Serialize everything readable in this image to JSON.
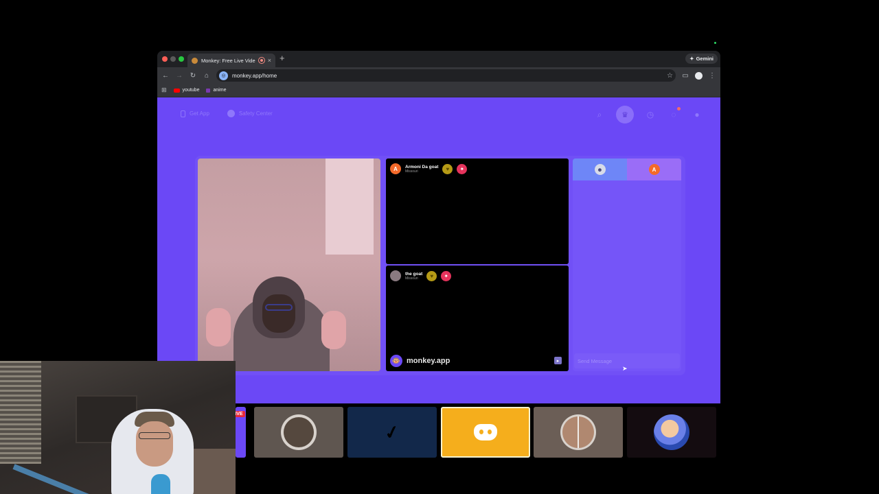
{
  "browser": {
    "tab_title": "Monkey: Free Live Video",
    "new_tab": "+",
    "close": "×",
    "gemini_label": "Gemini",
    "url": "monkey.app/home",
    "bookmarks": [
      {
        "label": "youtube"
      },
      {
        "label": "anime"
      }
    ]
  },
  "nav": {
    "get_app": "Get App",
    "safety_center": "Safety Center"
  },
  "video": {
    "stranger1": {
      "name": "Armoni Da goat",
      "sub": "Missouri",
      "avatar_letter": "A"
    },
    "stranger2": {
      "name": "the goat",
      "sub": "Missouri"
    },
    "watermark": "monkey.app"
  },
  "chat": {
    "placeholder": "Send Message",
    "tab2_letter": "A"
  },
  "tiles": {
    "live_tag": "LIVE"
  },
  "colors": {
    "brand_purple": "#6b48f6",
    "discord_tile": "#f5ae1c",
    "live_red": "#e8283a"
  }
}
